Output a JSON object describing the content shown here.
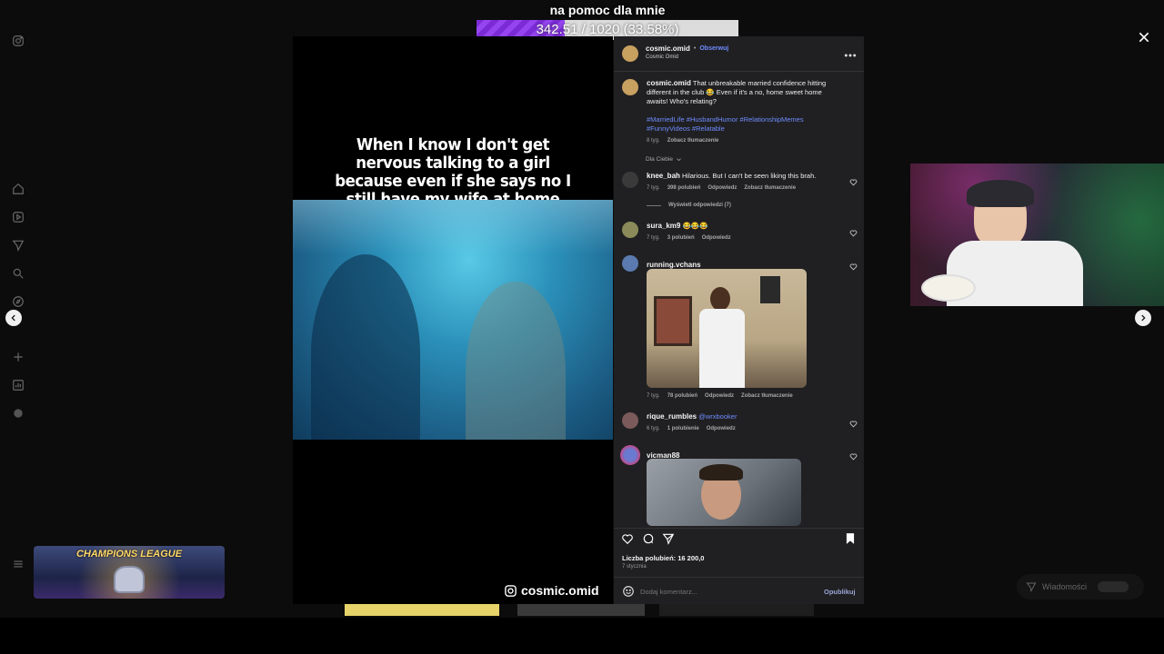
{
  "overlay": {
    "donation_title": "na pomoc dla mnie",
    "donation_progress_text": "342.51 / 1020 (33.58%)",
    "donation_progress": 0.3358
  },
  "post": {
    "author": "cosmic.omid",
    "follow_label": "Obserwuj",
    "author_fullname": "Cosmic Omid",
    "caption_user": "cosmic.omid",
    "caption_text": "That unbreakable married confidence hitting different in the club 😂 Even if it's a no, home sweet home awaits! Who's relating?",
    "hashtags": "#MarriedLife #HusbandHumor #RelationshipMemes #FunnyVideos #Relatable",
    "caption_age": "8 tyg.",
    "see_translation": "Zobacz tłumaczenie",
    "filter_label": "Dla Ciebie",
    "likes_text": "Liczba polubień: 16 200,0",
    "date_text": "7 stycznia",
    "comment_placeholder": "Dodaj komentarz...",
    "publish_label": "Opublikuj"
  },
  "video": {
    "meme_caption": "When I know I don't get nervous talking to a girl because even if she says no I still have my wife at home",
    "watermark": "cosmic.omid"
  },
  "comments": [
    {
      "user": "knee_bah",
      "text": "Hilarious. But I can't be seen liking this brah.",
      "age": "7 tyg.",
      "likes": "398 polubień",
      "reply": "Odpowiedz",
      "translate": "Zobacz tłumaczenie",
      "view_replies": "Wyświetl odpowiedzi (7)"
    },
    {
      "user": "sura_km9",
      "text": "😂😂😂",
      "age": "7 tyg.",
      "likes": "3 polubień",
      "reply": "Odpowiedz"
    },
    {
      "user": "running.vchans",
      "text": "",
      "age": "7 tyg.",
      "likes": "78 polubień",
      "reply": "Odpowiedz",
      "translate": "Zobacz tłumaczenie"
    },
    {
      "user": "rique_rumbles",
      "text": "@wrxbooker",
      "age": "6 tyg.",
      "likes": "1 polubienie",
      "reply": "Odpowiedz"
    },
    {
      "user": "vicman88",
      "text": ""
    }
  ],
  "stream": {
    "champions_label": "CHAMPIONS LEAGUE",
    "messages_label": "Wiadomości"
  },
  "colors": {
    "link": "#6e8cff",
    "donation_fill": "#8a3be6",
    "panel_bg": "#202022"
  },
  "icons": [
    "instagram-icon",
    "home-icon",
    "reels-icon",
    "send-icon",
    "search-icon",
    "explore-icon",
    "plus-icon",
    "insights-icon",
    "profile-icon",
    "menu-icon",
    "more-icon",
    "close-icon",
    "heart-icon",
    "comment-icon",
    "share-icon",
    "bookmark-icon",
    "emoji-icon",
    "chevron-left-icon",
    "chevron-right-icon"
  ]
}
